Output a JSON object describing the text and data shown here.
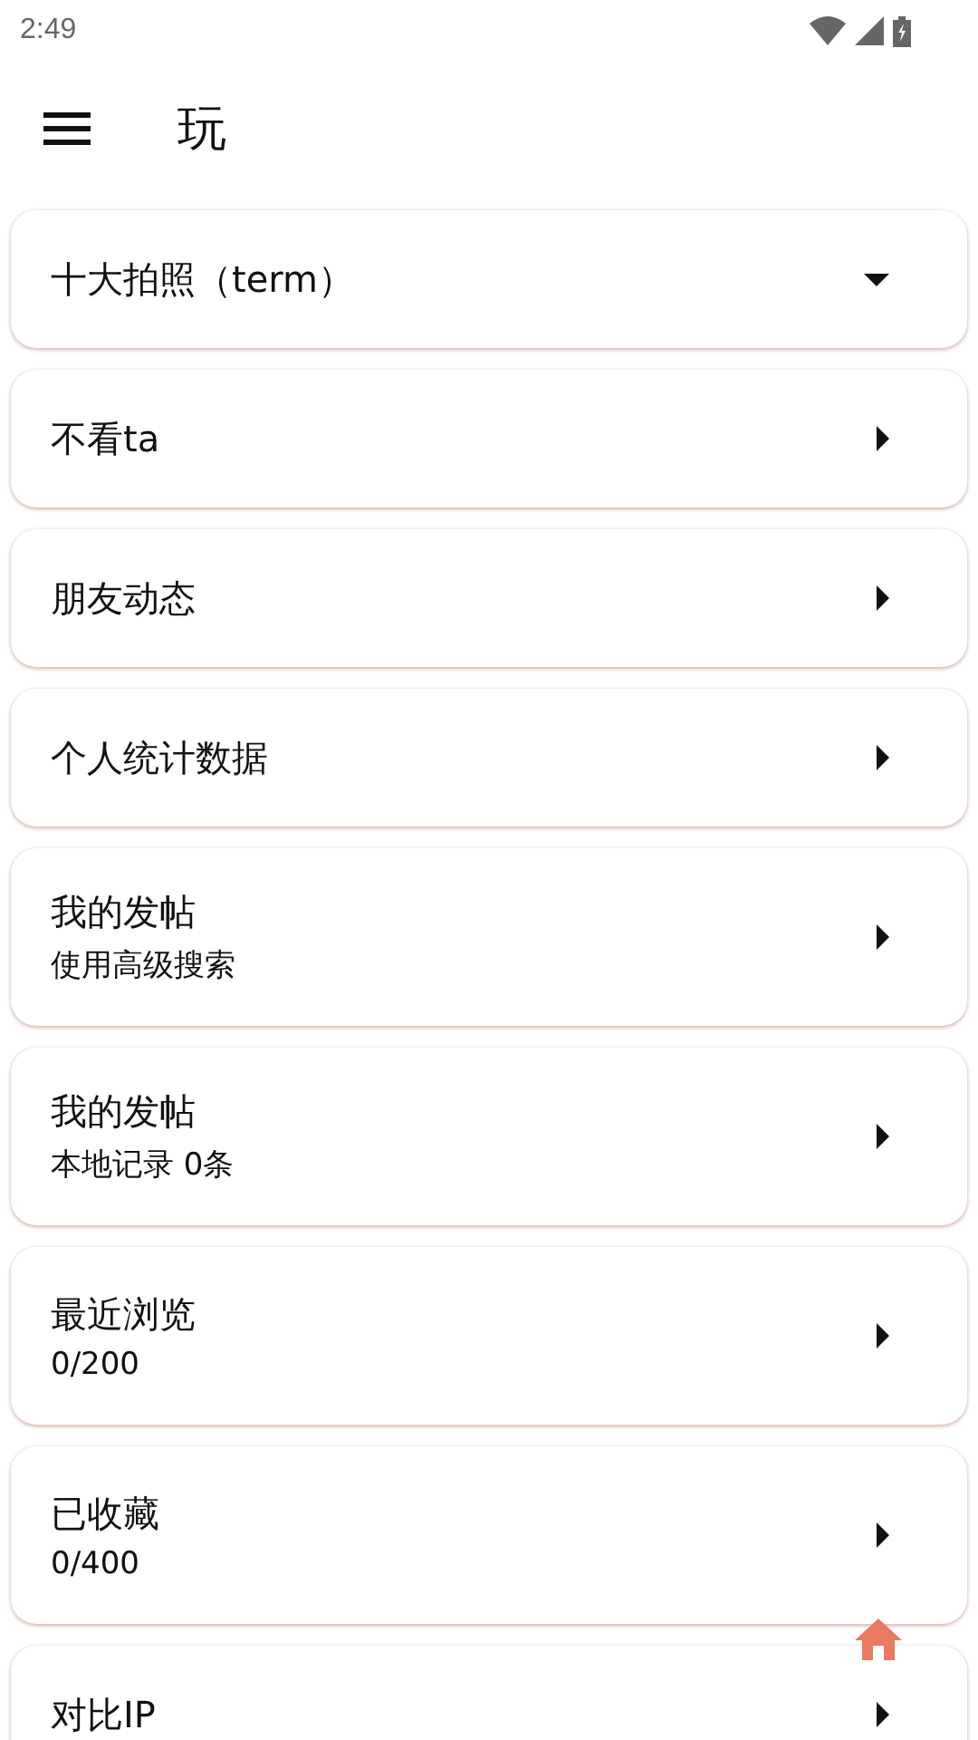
{
  "status_bar": {
    "time": "2:49"
  },
  "app_bar": {
    "title": "玩"
  },
  "items": [
    {
      "title": "十大拍照（term）",
      "expanded": true
    },
    {
      "title": "不看ta",
      "expanded": false
    },
    {
      "title": "朋友动态",
      "expanded": false
    },
    {
      "title": "个人统计数据",
      "expanded": false
    },
    {
      "title": "我的发帖",
      "subtitle": "使用高级搜索",
      "expanded": false
    },
    {
      "title": "我的发帖",
      "subtitle": "本地记录 0条",
      "expanded": false
    },
    {
      "title": "最近浏览",
      "subtitle": "0/200",
      "expanded": false
    },
    {
      "title": "已收藏",
      "subtitle": "0/400",
      "expanded": false
    },
    {
      "title": "对比IP",
      "expanded": false
    }
  ]
}
